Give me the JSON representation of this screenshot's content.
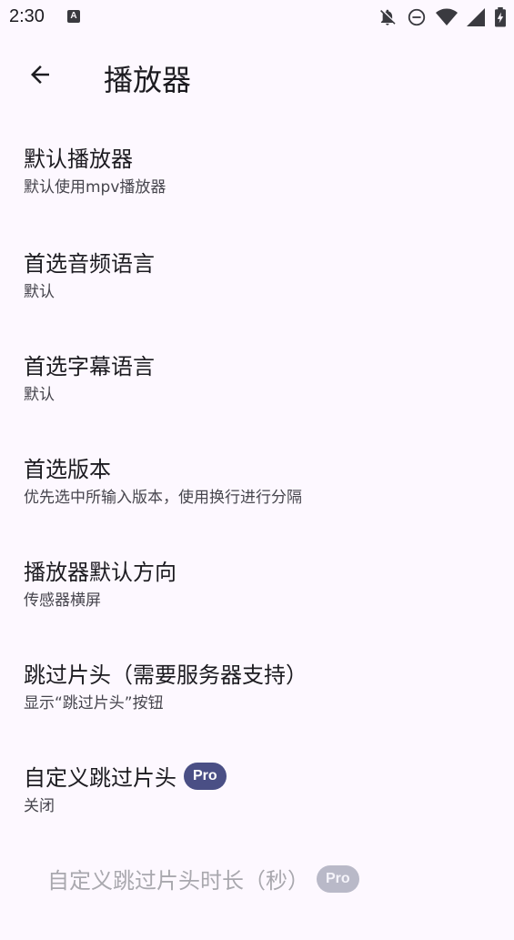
{
  "status_bar": {
    "time": "2:30",
    "a_glyph": "A",
    "icons": [
      "notifications-off-icon",
      "do-not-disturb-icon",
      "wifi-icon",
      "signal-icon",
      "battery-charging-icon"
    ]
  },
  "app_bar": {
    "back_icon": "arrow-back-icon",
    "title": "播放器"
  },
  "settings": [
    {
      "title": "默认播放器",
      "summary": "默认使用mpv播放器"
    },
    {
      "title": "首选音频语言",
      "summary": "默认"
    },
    {
      "title": "首选字幕语言",
      "summary": "默认"
    },
    {
      "title": "首选版本",
      "summary": "优先选中所输入版本，使用换行进行分隔"
    },
    {
      "title": "播放器默认方向",
      "summary": "传感器横屏"
    },
    {
      "title": "跳过片头（需要服务器支持）",
      "summary": "显示“跳过片头”按钮"
    },
    {
      "title": "自定义跳过片头",
      "badge": "Pro",
      "summary": "关闭"
    },
    {
      "title": "自定义跳过片头时长（秒）",
      "badge": "Pro",
      "enabled": false
    }
  ],
  "colors": {
    "background": "#fdf8ff",
    "pro_badge": "#4a4f85",
    "pro_badge_disabled": "#b9b9c8"
  }
}
